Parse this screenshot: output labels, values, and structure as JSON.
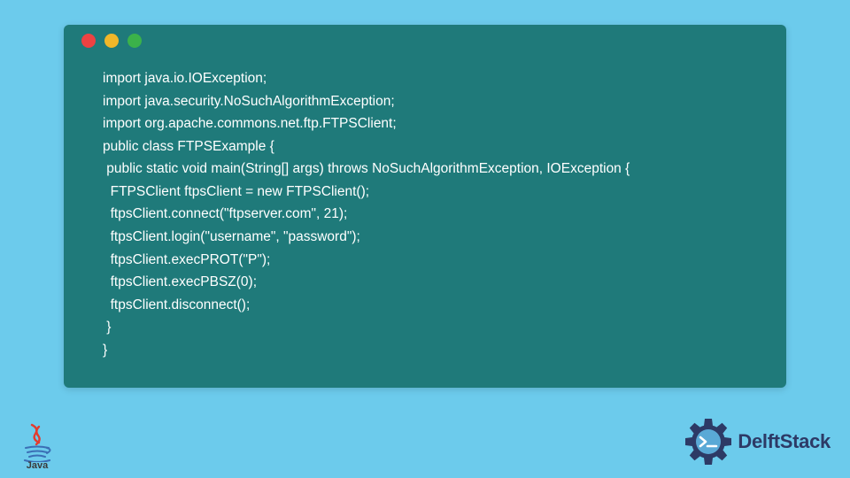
{
  "code": {
    "lines": [
      "import java.io.IOException;",
      "import java.security.NoSuchAlgorithmException;",
      "import org.apache.commons.net.ftp.FTPSClient;",
      "public class FTPSExample {",
      " public static void main(String[] args) throws NoSuchAlgorithmException, IOException {",
      "  FTPSClient ftpsClient = new FTPSClient();",
      "  ftpsClient.connect(\"ftpserver.com\", 21);",
      "  ftpsClient.login(\"username\", \"password\");",
      "  ftpsClient.execPROT(\"P\");",
      "  ftpsClient.execPBSZ(0);",
      "  ftpsClient.disconnect();",
      " }",
      "}"
    ]
  },
  "logos": {
    "java_label": "Java",
    "delft_label": "DelftStack"
  },
  "colors": {
    "page_bg": "#6ccbec",
    "window_bg": "#1f7a7a",
    "dot_red": "#ed4242",
    "dot_yellow": "#f0b729",
    "dot_green": "#3bb24a",
    "delft_blue": "#2d3a66"
  }
}
